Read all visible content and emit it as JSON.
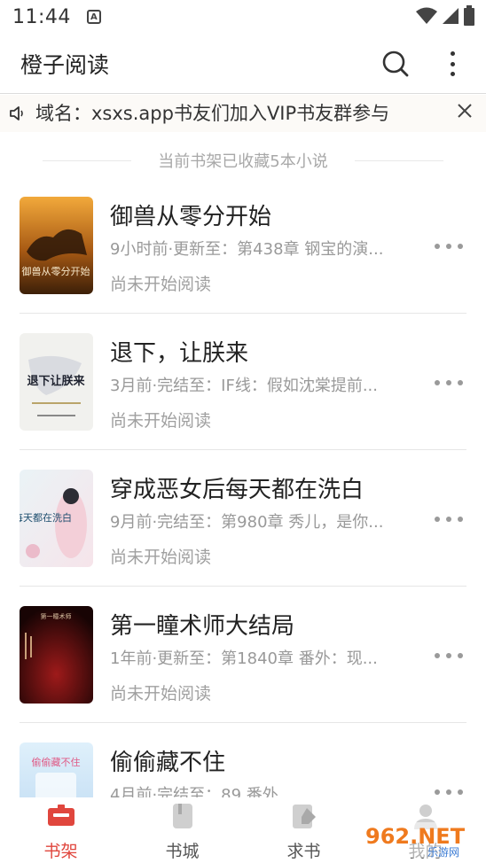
{
  "status_bar": {
    "time": "11:44"
  },
  "app_bar": {
    "title": "橙子阅读"
  },
  "notice": {
    "text": "域名：xsxs.app书友们加入VIP书友群参与"
  },
  "shelf": {
    "count_text": "当前书架已收藏5本小说"
  },
  "books": [
    {
      "title": "御兽从零分开始",
      "update": "9小时前·更新至：第438章 钢宝的演...",
      "progress": "尚未开始阅读",
      "cover_text": "御兽从零分开始"
    },
    {
      "title": "退下，让朕来",
      "update": "3月前·完结至：IF线：假如沈棠提前...",
      "progress": "尚未开始阅读",
      "cover_text": "退下让朕来"
    },
    {
      "title": "穿成恶女后每天都在洗白",
      "update": "9月前·完结至：第980章 秀儿，是你...",
      "progress": "尚未开始阅读",
      "cover_text": "每天都在洗白"
    },
    {
      "title": "第一瞳术师大结局",
      "update": "1年前·更新至：第1840章 番外：现...",
      "progress": "尚未开始阅读",
      "cover_text": "第一瞳术师"
    },
    {
      "title": "偷偷藏不住",
      "update": "4月前·完结至：89 番外",
      "progress": "",
      "cover_text": "偷偷藏不住"
    }
  ],
  "bottom_nav": [
    {
      "label": "书架",
      "icon": "bookshelf-icon",
      "active": true
    },
    {
      "label": "书城",
      "icon": "bookstore-icon",
      "active": false
    },
    {
      "label": "求书",
      "icon": "request-book-icon",
      "active": false
    },
    {
      "label": "我的",
      "icon": "profile-icon",
      "active": false
    }
  ],
  "watermark": {
    "text": "962.NET",
    "subtext": "乐游网"
  },
  "colors": {
    "accent": "#e0463d",
    "muted": "#999999"
  }
}
